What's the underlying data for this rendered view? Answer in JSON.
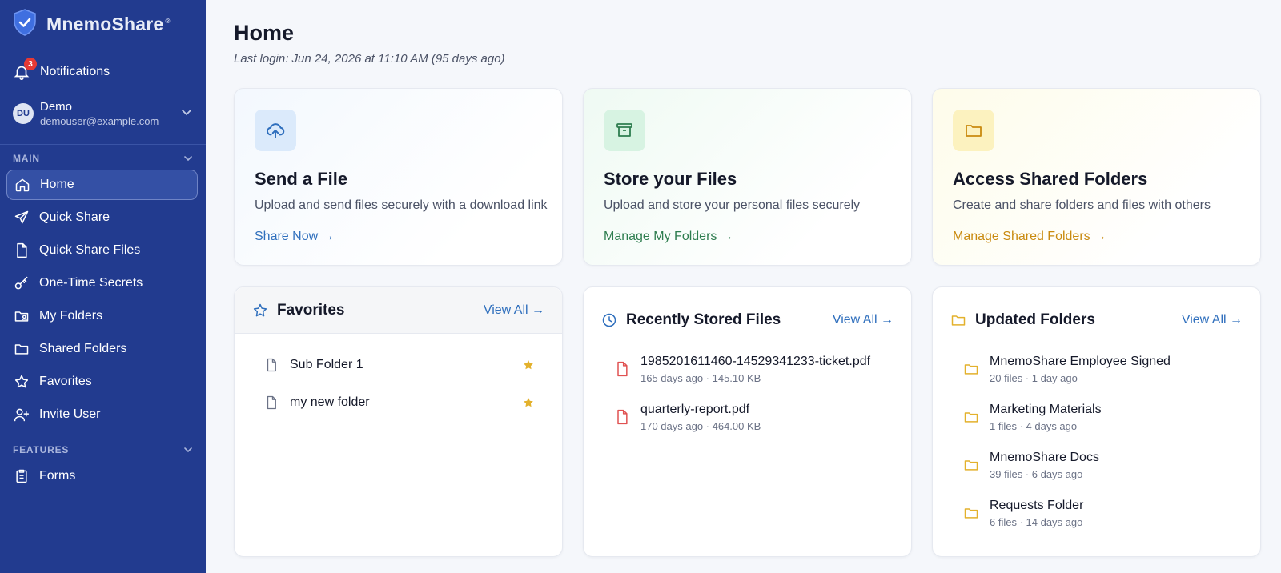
{
  "brand": {
    "name": "MnemoShare",
    "reg": "®"
  },
  "notifications": {
    "label": "Notifications",
    "count": "3"
  },
  "user": {
    "initials": "DU",
    "name": "Demo",
    "email": "demouser@example.com"
  },
  "sections": {
    "main": "MAIN",
    "features": "FEATURES"
  },
  "nav": {
    "main": [
      {
        "label": "Home"
      },
      {
        "label": "Quick Share"
      },
      {
        "label": "Quick Share Files"
      },
      {
        "label": "One-Time Secrets"
      },
      {
        "label": "My Folders"
      },
      {
        "label": "Shared Folders"
      },
      {
        "label": "Favorites"
      },
      {
        "label": "Invite User"
      }
    ],
    "features": [
      {
        "label": "Forms"
      }
    ]
  },
  "page": {
    "title": "Home",
    "last_login": "Last login: Jun 24, 2026 at 11:10 AM (95 days ago)"
  },
  "features": [
    {
      "title": "Send a File",
      "desc": "Upload and send files securely with a download link",
      "link": "Share Now →",
      "color": "#2f6fbd"
    },
    {
      "title": "Store your Files",
      "desc": "Upload and store your personal files securely",
      "link": "Manage My Folders →",
      "color": "#2e7d4f"
    },
    {
      "title": "Access Shared Folders",
      "desc": "Create and share folders and files with others",
      "link": "Manage Shared Folders →",
      "color": "#c98a0f"
    }
  ],
  "favorites": {
    "title": "Favorites",
    "view_all": "View All →",
    "items": [
      {
        "name": "Sub Folder 1"
      },
      {
        "name": "my new folder"
      }
    ]
  },
  "recent_files": {
    "title": "Recently Stored Files",
    "view_all": "View All →",
    "items": [
      {
        "name": "1985201611460-14529341233-ticket.pdf",
        "meta": "165 days ago · 145.10 KB"
      },
      {
        "name": "quarterly-report.pdf",
        "meta": "170 days ago · 464.00 KB"
      }
    ]
  },
  "updated_folders": {
    "title": "Updated Folders",
    "view_all": "View All →",
    "items": [
      {
        "name": "MnemoShare Employee Signed",
        "meta": "20 files · 1 day ago"
      },
      {
        "name": "Marketing Materials",
        "meta": "1 files · 4 days ago"
      },
      {
        "name": "MnemoShare Docs",
        "meta": "39 files · 6 days ago"
      },
      {
        "name": "Requests Folder",
        "meta": "6 files · 14 days ago"
      }
    ]
  },
  "colors": {
    "sidebar": "#223b8f",
    "accent_blue": "#2f6fbd",
    "accent_green": "#2e7d4f",
    "accent_gold": "#c98a0f",
    "star": "#e3b12c",
    "pdf": "#e05252"
  }
}
